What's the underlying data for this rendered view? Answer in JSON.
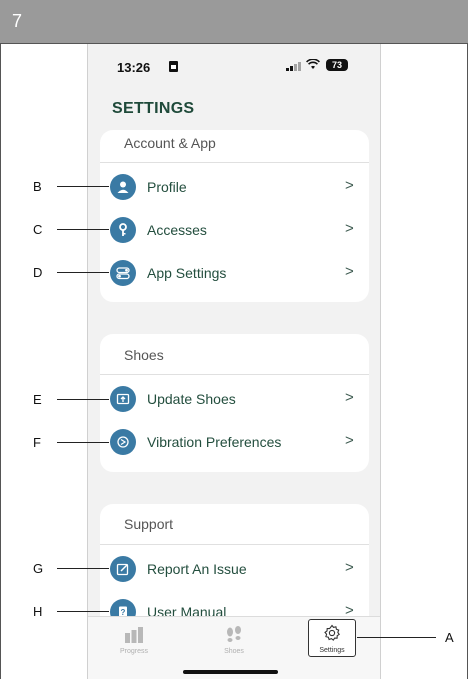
{
  "header": {
    "step_number": "7"
  },
  "status_bar": {
    "time": "13:26",
    "battery": "73"
  },
  "title": "SETTINGS",
  "sections": [
    {
      "header": "Account & App",
      "items": [
        {
          "label": "Profile",
          "icon": "person-icon",
          "callout": "B"
        },
        {
          "label": "Accesses",
          "icon": "key-icon",
          "callout": "C"
        },
        {
          "label": "App Settings",
          "icon": "toggles-icon",
          "callout": "D"
        }
      ]
    },
    {
      "header": "Shoes",
      "items": [
        {
          "label": "Update Shoes",
          "icon": "upload-box-icon",
          "callout": "E"
        },
        {
          "label": "Vibration Preferences",
          "icon": "vibration-icon",
          "callout": "F"
        }
      ]
    },
    {
      "header": "Support",
      "items": [
        {
          "label": "Report An Issue",
          "icon": "edit-icon",
          "callout": "G"
        },
        {
          "label": "User Manual",
          "icon": "book-icon",
          "callout": "H"
        }
      ]
    }
  ],
  "tabs": [
    {
      "label": "Progress",
      "icon": "chart-icon",
      "active": false
    },
    {
      "label": "Shoes",
      "icon": "footprints-icon",
      "active": false
    },
    {
      "label": "Settings",
      "icon": "gear-icon",
      "active": true,
      "callout": "A"
    }
  ],
  "chevron": ">",
  "colors": {
    "accent": "#3a7aa4",
    "title": "#1f4a3a",
    "header_bar": "#9a9a9a"
  }
}
